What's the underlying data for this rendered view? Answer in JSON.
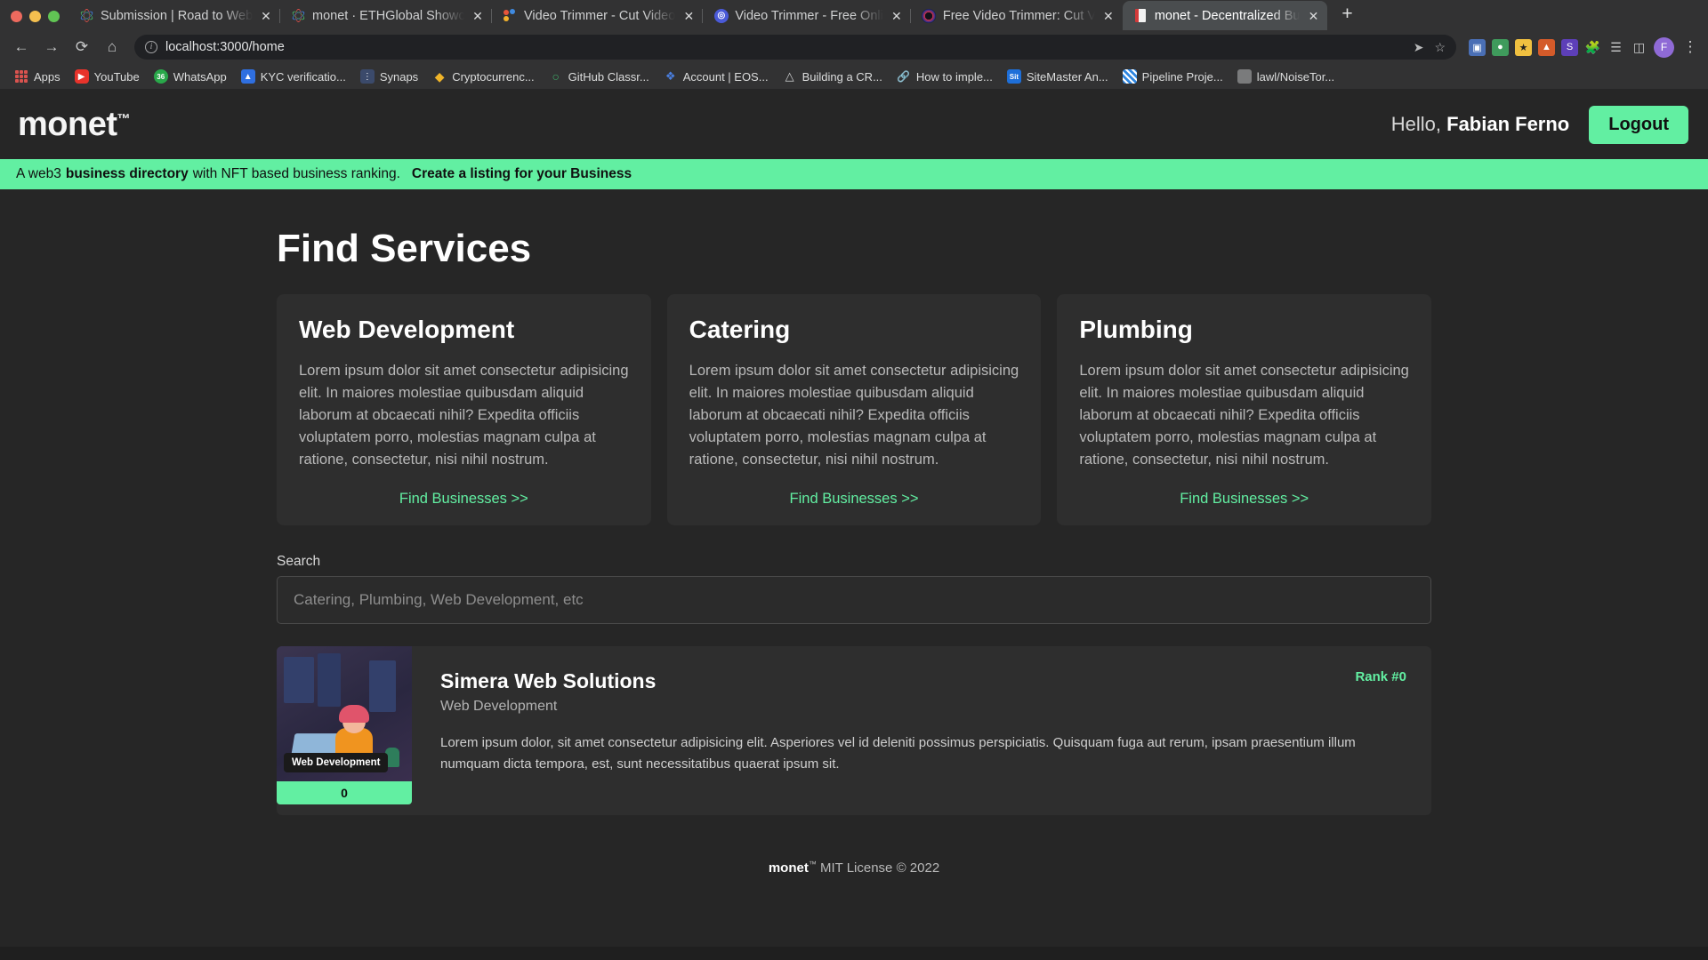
{
  "browser": {
    "tabs": [
      {
        "title": "Submission | Road to Web",
        "favicon": "atom-icon",
        "active": false
      },
      {
        "title": "monet · ETHGlobal Showc",
        "favicon": "atom-icon",
        "active": false
      },
      {
        "title": "Video Trimmer - Cut Video",
        "favicon": "dots-icon",
        "active": false
      },
      {
        "title": "Video Trimmer - Free Onli",
        "favicon": "circle-icon",
        "active": false
      },
      {
        "title": "Free Video Trimmer: Cut V",
        "favicon": "ring-icon",
        "active": false
      },
      {
        "title": "monet - Decentralized Bu",
        "favicon": "book-icon",
        "active": true
      }
    ],
    "new_tab_label": "+",
    "close_label": "✕",
    "nav": {
      "back": "←",
      "forward": "→",
      "reload": "⟳",
      "home": "⌂",
      "url": "localhost:3000/home",
      "info_icon": "i",
      "share_icon": "➤",
      "bookmark_star_icon": "☆",
      "kebab_icon": "⋮",
      "avatar_label": "F"
    },
    "bookmarks": [
      {
        "label": "Apps",
        "icon": "apps-grid-icon"
      },
      {
        "label": "YouTube",
        "icon": "youtube-icon"
      },
      {
        "label": "WhatsApp",
        "icon": "whatsapp-icon",
        "badge": "36"
      },
      {
        "label": "KYC verificatio...",
        "icon": "kyc-icon"
      },
      {
        "label": "Synaps",
        "icon": "synaps-icon"
      },
      {
        "label": "Cryptocurrenc...",
        "icon": "crypto-icon"
      },
      {
        "label": "GitHub Classr...",
        "icon": "github-icon"
      },
      {
        "label": "Account | EOS...",
        "icon": "eos-icon"
      },
      {
        "label": "Building a CR...",
        "icon": "notion-icon"
      },
      {
        "label": "How to imple...",
        "icon": "link-icon"
      },
      {
        "label": "SiteMaster An...",
        "icon": "sitemaster-icon"
      },
      {
        "label": "Pipeline Proje...",
        "icon": "pipeline-icon"
      },
      {
        "label": "lawl/NoiseTor...",
        "icon": "generic-icon"
      }
    ]
  },
  "site": {
    "logo": "monet",
    "logo_tm": "™",
    "greeting_prefix": "Hello,",
    "user_name": "Fabian Ferno",
    "logout_label": "Logout",
    "banner": {
      "text_before": "A web3",
      "bold_1": "business directory",
      "text_after": "with NFT based business ranking.",
      "link": "Create a listing for your Business"
    },
    "accent_color": "#62efa2",
    "page_bg": "#262626",
    "card_bg": "#2e2e2e"
  },
  "main": {
    "title": "Find Services",
    "service_cards": [
      {
        "title": "Web Development",
        "description": "Lorem ipsum dolor sit amet consectetur adipisicing elit. In maiores molestiae quibusdam aliquid laborum at obcaecati nihil? Expedita officiis voluptatem porro, molestias magnam culpa at ratione, consectetur, nisi nihil nostrum.",
        "cta": "Find Businesses >>"
      },
      {
        "title": "Catering",
        "description": "Lorem ipsum dolor sit amet consectetur adipisicing elit. In maiores molestiae quibusdam aliquid laborum at obcaecati nihil? Expedita officiis voluptatem porro, molestias magnam culpa at ratione, consectetur, nisi nihil nostrum.",
        "cta": "Find Businesses >>"
      },
      {
        "title": "Plumbing",
        "description": "Lorem ipsum dolor sit amet consectetur adipisicing elit. In maiores molestiae quibusdam aliquid laborum at obcaecati nihil? Expedita officiis voluptatem porro, molestias magnam culpa at ratione, consectetur, nisi nihil nostrum.",
        "cta": "Find Businesses >>"
      }
    ],
    "search": {
      "label": "Search",
      "placeholder": "Catering, Plumbing, Web Development, etc",
      "value": ""
    },
    "listings": [
      {
        "name": "Simera Web Solutions",
        "category": "Web Development",
        "rank": "Rank #0",
        "description": "Lorem ipsum dolor, sit amet consectetur adipisicing elit. Asperiores vel id deleniti possimus perspiciatis. Quisquam fuga aut rerum, ipsam praesentium illum numquam dicta tempora, est, sunt necessitatibus quaerat ipsum sit.",
        "thumb_tag": "Web Development",
        "count": "0"
      }
    ]
  },
  "footer": {
    "brand": "monet",
    "tm": "™",
    "text": " MIT License © 2022"
  }
}
